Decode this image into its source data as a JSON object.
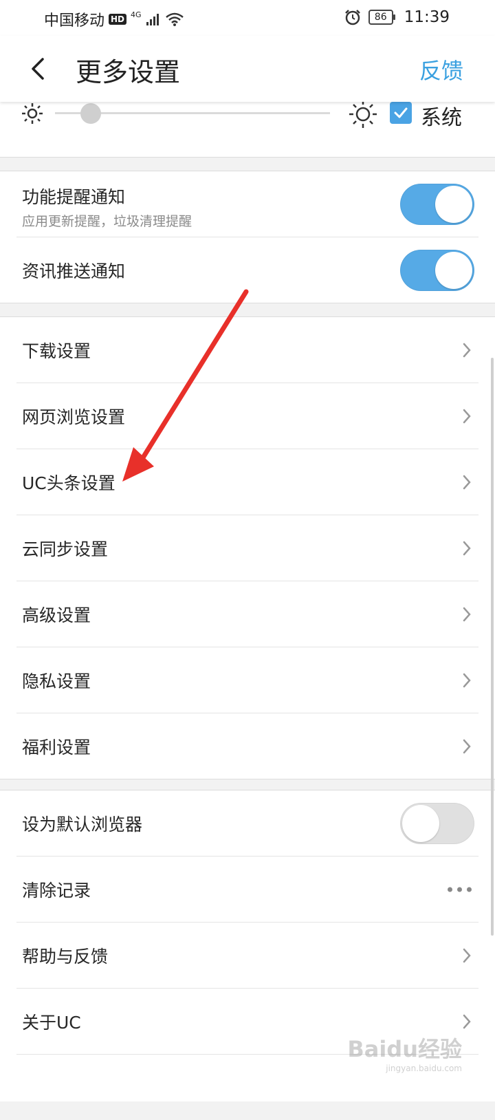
{
  "status_bar": {
    "carrier": "中国移动",
    "hd": "HD",
    "network": "4G",
    "battery": "86",
    "time": "11:39"
  },
  "header": {
    "title": "更多设置",
    "feedback_label": "反馈"
  },
  "brightness": {
    "level_fraction": 0.13,
    "system_label": "系统",
    "system_checked": true
  },
  "notifications": [
    {
      "label": "功能提醒通知",
      "sub": "应用更新提醒，垃圾清理提醒",
      "enabled": true
    },
    {
      "label": "资讯推送通知",
      "enabled": true
    }
  ],
  "settings_list": [
    {
      "label": "下载设置"
    },
    {
      "label": "网页浏览设置"
    },
    {
      "label": "UC头条设置"
    },
    {
      "label": "云同步设置"
    },
    {
      "label": "高级设置"
    },
    {
      "label": "隐私设置"
    },
    {
      "label": "福利设置"
    }
  ],
  "misc_list": {
    "default_browser": {
      "label": "设为默认浏览器",
      "enabled": false
    },
    "clear_records": {
      "label": "清除记录"
    },
    "help": {
      "label": "帮助与反馈"
    },
    "about": {
      "label": "关于UC"
    }
  },
  "watermark": {
    "text": "Baidu经验",
    "sub": "jingyan.baidu.com"
  },
  "colors": {
    "accent": "#3aa0e0",
    "toggle_on": "#56aae6",
    "arrow": "#e8302a"
  }
}
